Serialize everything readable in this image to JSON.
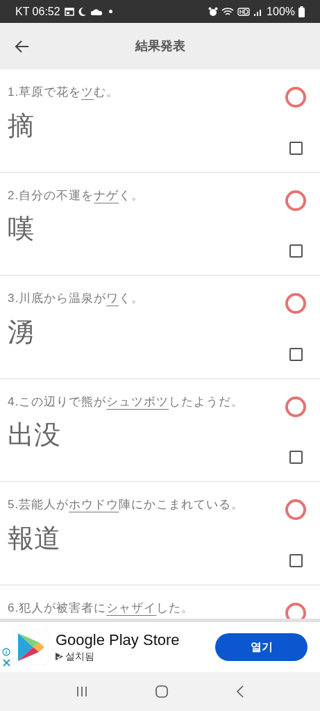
{
  "status_bar": {
    "carrier_time": "KT 06:52",
    "battery": "100%"
  },
  "header": {
    "title": "結果発表"
  },
  "questions": [
    {
      "number": "1.",
      "prefix": "草原で花を",
      "target": "ツ",
      "suffix": "む。",
      "correct": true,
      "answer": "摘",
      "checked": false
    },
    {
      "number": "2.",
      "prefix": "自分の不運を",
      "target": "ナゲ",
      "suffix": "く。",
      "correct": true,
      "answer": "嘆",
      "checked": false
    },
    {
      "number": "3.",
      "prefix": "川底から温泉が",
      "target": "ワ",
      "suffix": "く。",
      "correct": true,
      "answer": "湧",
      "checked": false
    },
    {
      "number": "4.",
      "prefix": "この辺りで熊が",
      "target": "シュツボツ",
      "suffix": "したようだ。",
      "correct": true,
      "answer": "出没",
      "checked": false
    },
    {
      "number": "5.",
      "prefix": "芸能人が",
      "target": "ホウドウ",
      "suffix": "陣にかこまれている。",
      "correct": true,
      "answer": "報道",
      "checked": false
    },
    {
      "number": "6.",
      "prefix": "犯人が被害者に",
      "target": "シャザイ",
      "suffix": "した。",
      "correct": true
    }
  ],
  "ad": {
    "title": "Google Play Store",
    "subtitle": "설치됨",
    "button": "열기"
  }
}
